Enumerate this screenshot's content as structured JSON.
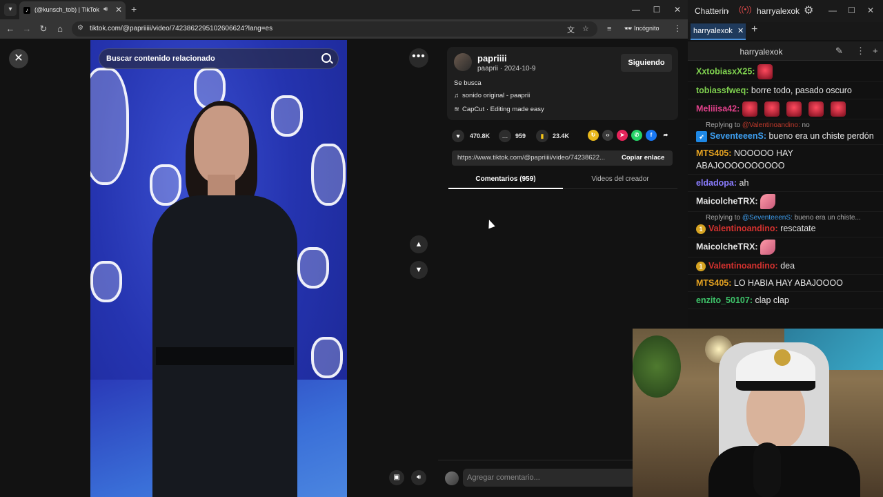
{
  "browser": {
    "tab_title": "(@kunsch_tob) | TikTok",
    "url": "tiktok.com/@papriiiii/video/7423862295102606624?lang=es",
    "incognito_label": "Incógnito"
  },
  "tiktok": {
    "search_placeholder": "Buscar contenido relacionado",
    "author_name": "papriiii",
    "author_sub": "paaprii · 2024-10-9",
    "follow_label": "Siguiendo",
    "description": "Se busca",
    "sound": "sonido original - paaprii",
    "capcut": "CapCut · Editing made easy",
    "likes": "470.8K",
    "comments": "959",
    "saves": "23.4K",
    "link": "https://www.tiktok.com/@papriiiii/video/74238622...",
    "copy_link_label": "Copiar enlace",
    "tab_comments": "Comentarios (959)",
    "tab_creator_videos": "Videos del creador",
    "comment_placeholder": "Agregar comentario..."
  },
  "chat": {
    "app_title": "Chatterino",
    "live_user": "harryalexok",
    "tab_label": "harryalexok",
    "channel": "harryalexok",
    "messages": [
      {
        "user": "XxtobiasxX25:",
        "color": "#7fd14f",
        "text": ""
      },
      {
        "user": "tobiassfweq:",
        "color": "#7fd14f",
        "text": "borre todo, pasado oscuro"
      },
      {
        "user": "Meliiisa42:",
        "color": "#e0418a",
        "text": ""
      },
      {
        "reply_prefix": "Replying to",
        "reply_mention": "@Valentinoandino:",
        "reply_text": "no",
        "user": "SeventeeenS:",
        "color": "#3ea0f2",
        "text": "bueno era un chiste perdón"
      },
      {
        "user": "MTS405:",
        "color": "#e6a321",
        "text": "NOOOOO HAY ABAJOOOOOOOOOO"
      },
      {
        "user": "eldadopa:",
        "color": "#8a7cff",
        "text": "ah"
      },
      {
        "user": "MaicolcheTRX:",
        "color": "#e6e6e6",
        "text": ""
      },
      {
        "reply_prefix": "Replying to",
        "reply_mention": "@SeventeeenS:",
        "reply_text": "bueno era un chiste...",
        "user": "Valentinoandino:",
        "color": "#d6322f",
        "text": "rescatate"
      },
      {
        "user": "MaicolcheTRX:",
        "color": "#e6e6e6",
        "text": ""
      },
      {
        "user": "Valentinoandino:",
        "color": "#d6322f",
        "text": "dea"
      },
      {
        "user": "MTS405:",
        "color": "#e6a321",
        "text": "LO HABIA HAY ABAJOOOO"
      },
      {
        "user": "enzito_50107:",
        "color": "#3ec46a",
        "text": "clap clap"
      }
    ]
  }
}
